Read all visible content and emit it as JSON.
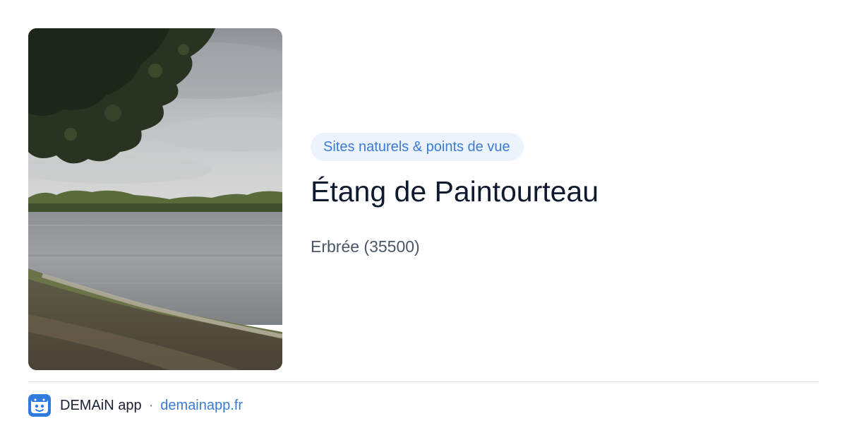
{
  "place": {
    "category": "Sites naturels & points de vue",
    "name": "Étang de Paintourteau",
    "location": "Erbrée (35500)",
    "photo_subject": "lake-photo"
  },
  "footer": {
    "app_name": "DEMAiN app",
    "separator": "·",
    "url": "demainapp.fr",
    "logo_icon": "demain-app-logo-icon"
  },
  "colors": {
    "accent": "#3a7bd5",
    "tag_background": "#edf3fc",
    "title": "#0f1a2e",
    "subtitle": "#4a5668",
    "divider": "#d8dfe5"
  }
}
